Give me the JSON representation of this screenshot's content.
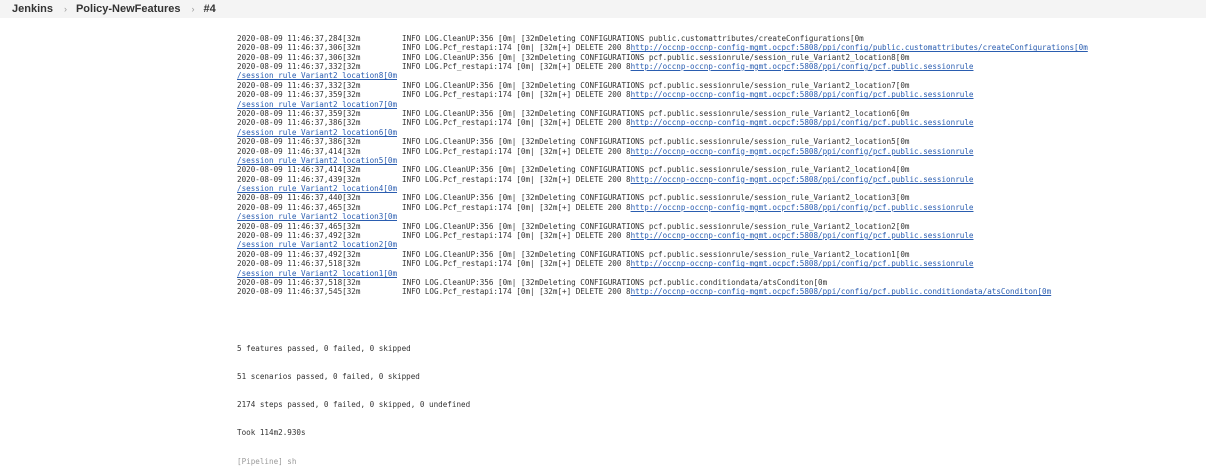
{
  "breadcrumb": {
    "items": [
      "Jenkins",
      "Policy-NewFeatures",
      "#4"
    ]
  },
  "console": {
    "lines": [
      {
        "ts": "2020-08-09 11:46:37,284[32m",
        "msg": "INFO LOG.CleanUP:356 [0m| [32mDeleting CONFIGURATIONS public.customattributes/createConfigurations[0m",
        "link": ""
      },
      {
        "ts": "2020-08-09 11:46:37,306[32m",
        "msg": "INFO LOG.Pcf_restapi:174 [0m| [32m[+] DELETE 200 8",
        "link": "http://occnp-occnp-config-mgmt.ocpcf:5808/ppi/config/public.customattributes/createConfigurations[0m"
      },
      {
        "ts": "2020-08-09 11:46:37,306[32m",
        "msg": "INFO LOG.CleanUP:356 [0m| [32mDeleting CONFIGURATIONS pcf.public.sessionrule/session_rule_Variant2_location8[0m",
        "link": ""
      },
      {
        "ts": "2020-08-09 11:46:37,332[32m",
        "msg": "INFO LOG.Pcf_restapi:174 [0m| [32m[+] DELETE 200 8",
        "link": "http://occnp-occnp-config-mgmt.ocpcf:5808/ppi/config/pcf.public.sessionrule"
      },
      {
        "ts": "",
        "msg": "",
        "link": "/session_rule_Variant2_location8[0m"
      },
      {
        "ts": "2020-08-09 11:46:37,332[32m",
        "msg": "INFO LOG.CleanUP:356 [0m| [32mDeleting CONFIGURATIONS pcf.public.sessionrule/session_rule_Variant2_location7[0m",
        "link": ""
      },
      {
        "ts": "2020-08-09 11:46:37,359[32m",
        "msg": "INFO LOG.Pcf_restapi:174 [0m| [32m[+] DELETE 200 8",
        "link": "http://occnp-occnp-config-mgmt.ocpcf:5808/ppi/config/pcf.public.sessionrule"
      },
      {
        "ts": "",
        "msg": "",
        "link": "/session_rule_Variant2_location7[0m"
      },
      {
        "ts": "2020-08-09 11:46:37,359[32m",
        "msg": "INFO LOG.CleanUP:356 [0m| [32mDeleting CONFIGURATIONS pcf.public.sessionrule/session_rule_Variant2_location6[0m",
        "link": ""
      },
      {
        "ts": "2020-08-09 11:46:37,386[32m",
        "msg": "INFO LOG.Pcf_restapi:174 [0m| [32m[+] DELETE 200 8",
        "link": "http://occnp-occnp-config-mgmt.ocpcf:5808/ppi/config/pcf.public.sessionrule"
      },
      {
        "ts": "",
        "msg": "",
        "link": "/session_rule_Variant2_location6[0m"
      },
      {
        "ts": "2020-08-09 11:46:37,386[32m",
        "msg": "INFO LOG.CleanUP:356 [0m| [32mDeleting CONFIGURATIONS pcf.public.sessionrule/session_rule_Variant2_location5[0m",
        "link": ""
      },
      {
        "ts": "2020-08-09 11:46:37,414[32m",
        "msg": "INFO LOG.Pcf_restapi:174 [0m| [32m[+] DELETE 200 8",
        "link": "http://occnp-occnp-config-mgmt.ocpcf:5808/ppi/config/pcf.public.sessionrule"
      },
      {
        "ts": "",
        "msg": "",
        "link": "/session_rule_Variant2_location5[0m"
      },
      {
        "ts": "2020-08-09 11:46:37,414[32m",
        "msg": "INFO LOG.CleanUP:356 [0m| [32mDeleting CONFIGURATIONS pcf.public.sessionrule/session_rule_Variant2_location4[0m",
        "link": ""
      },
      {
        "ts": "2020-08-09 11:46:37,439[32m",
        "msg": "INFO LOG.Pcf_restapi:174 [0m| [32m[+] DELETE 200 8",
        "link": "http://occnp-occnp-config-mgmt.ocpcf:5808/ppi/config/pcf.public.sessionrule"
      },
      {
        "ts": "",
        "msg": "",
        "link": "/session_rule_Variant2_location4[0m"
      },
      {
        "ts": "2020-08-09 11:46:37,440[32m",
        "msg": "INFO LOG.CleanUP:356 [0m| [32mDeleting CONFIGURATIONS pcf.public.sessionrule/session_rule_Variant2_location3[0m",
        "link": ""
      },
      {
        "ts": "2020-08-09 11:46:37,465[32m",
        "msg": "INFO LOG.Pcf_restapi:174 [0m| [32m[+] DELETE 200 8",
        "link": "http://occnp-occnp-config-mgmt.ocpcf:5808/ppi/config/pcf.public.sessionrule"
      },
      {
        "ts": "",
        "msg": "",
        "link": "/session_rule_Variant2_location3[0m"
      },
      {
        "ts": "2020-08-09 11:46:37,465[32m",
        "msg": "INFO LOG.CleanUP:356 [0m| [32mDeleting CONFIGURATIONS pcf.public.sessionrule/session_rule_Variant2_location2[0m",
        "link": ""
      },
      {
        "ts": "2020-08-09 11:46:37,492[32m",
        "msg": "INFO LOG.Pcf_restapi:174 [0m| [32m[+] DELETE 200 8",
        "link": "http://occnp-occnp-config-mgmt.ocpcf:5808/ppi/config/pcf.public.sessionrule"
      },
      {
        "ts": "",
        "msg": "",
        "link": "/session_rule_Variant2_location2[0m"
      },
      {
        "ts": "2020-08-09 11:46:37,492[32m",
        "msg": "INFO LOG.CleanUP:356 [0m| [32mDeleting CONFIGURATIONS pcf.public.sessionrule/session_rule_Variant2_location1[0m",
        "link": ""
      },
      {
        "ts": "2020-08-09 11:46:37,518[32m",
        "msg": "INFO LOG.Pcf_restapi:174 [0m| [32m[+] DELETE 200 8",
        "link": "http://occnp-occnp-config-mgmt.ocpcf:5808/ppi/config/pcf.public.sessionrule"
      },
      {
        "ts": "",
        "msg": "",
        "link": "/session_rule_Variant2_location1[0m"
      },
      {
        "ts": "2020-08-09 11:46:37,518[32m",
        "msg": "INFO LOG.CleanUP:356 [0m| [32mDeleting CONFIGURATIONS pcf.public.conditiondata/atsConditon[0m",
        "link": ""
      },
      {
        "ts": "2020-08-09 11:46:37,545[32m",
        "msg": "INFO LOG.Pcf_restapi:174 [0m| [32m[+] DELETE 200 8",
        "link": "http://occnp-occnp-config-mgmt.ocpcf:5808/ppi/config/pcf.public.conditiondata/atsConditon[0m"
      }
    ],
    "summary": [
      "5 features passed, 0 failed, 0 skipped",
      "51 scenarios passed, 0 failed, 0 skipped",
      "2174 steps passed, 0 failed, 0 skipped, 0 undefined",
      "Took 114m2.930s"
    ],
    "pipeline_line": "[Pipeline] sh"
  }
}
